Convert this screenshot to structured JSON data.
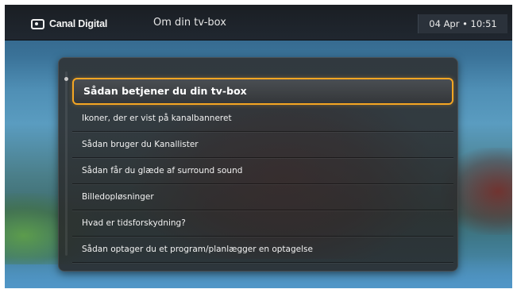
{
  "header": {
    "brand": "Canal Digital",
    "title": "Om din tv-box",
    "datetime": "04 Apr • 10:51"
  },
  "menu": {
    "items": [
      {
        "label": "Sådan betjener du din tv-box",
        "selected": true
      },
      {
        "label": "Ikoner, der er vist på kanalbanneret",
        "selected": false
      },
      {
        "label": "Sådan bruger du Kanallister",
        "selected": false
      },
      {
        "label": "Sådan får du glæde af surround sound",
        "selected": false
      },
      {
        "label": "Billedopløsninger",
        "selected": false
      },
      {
        "label": "Hvad er tidsforskydning?",
        "selected": false
      },
      {
        "label": "Sådan optager du et program/planlægger en optagelse",
        "selected": false
      }
    ]
  },
  "colors": {
    "accent": "#f5a623",
    "header_bg": "#1a1e23"
  }
}
